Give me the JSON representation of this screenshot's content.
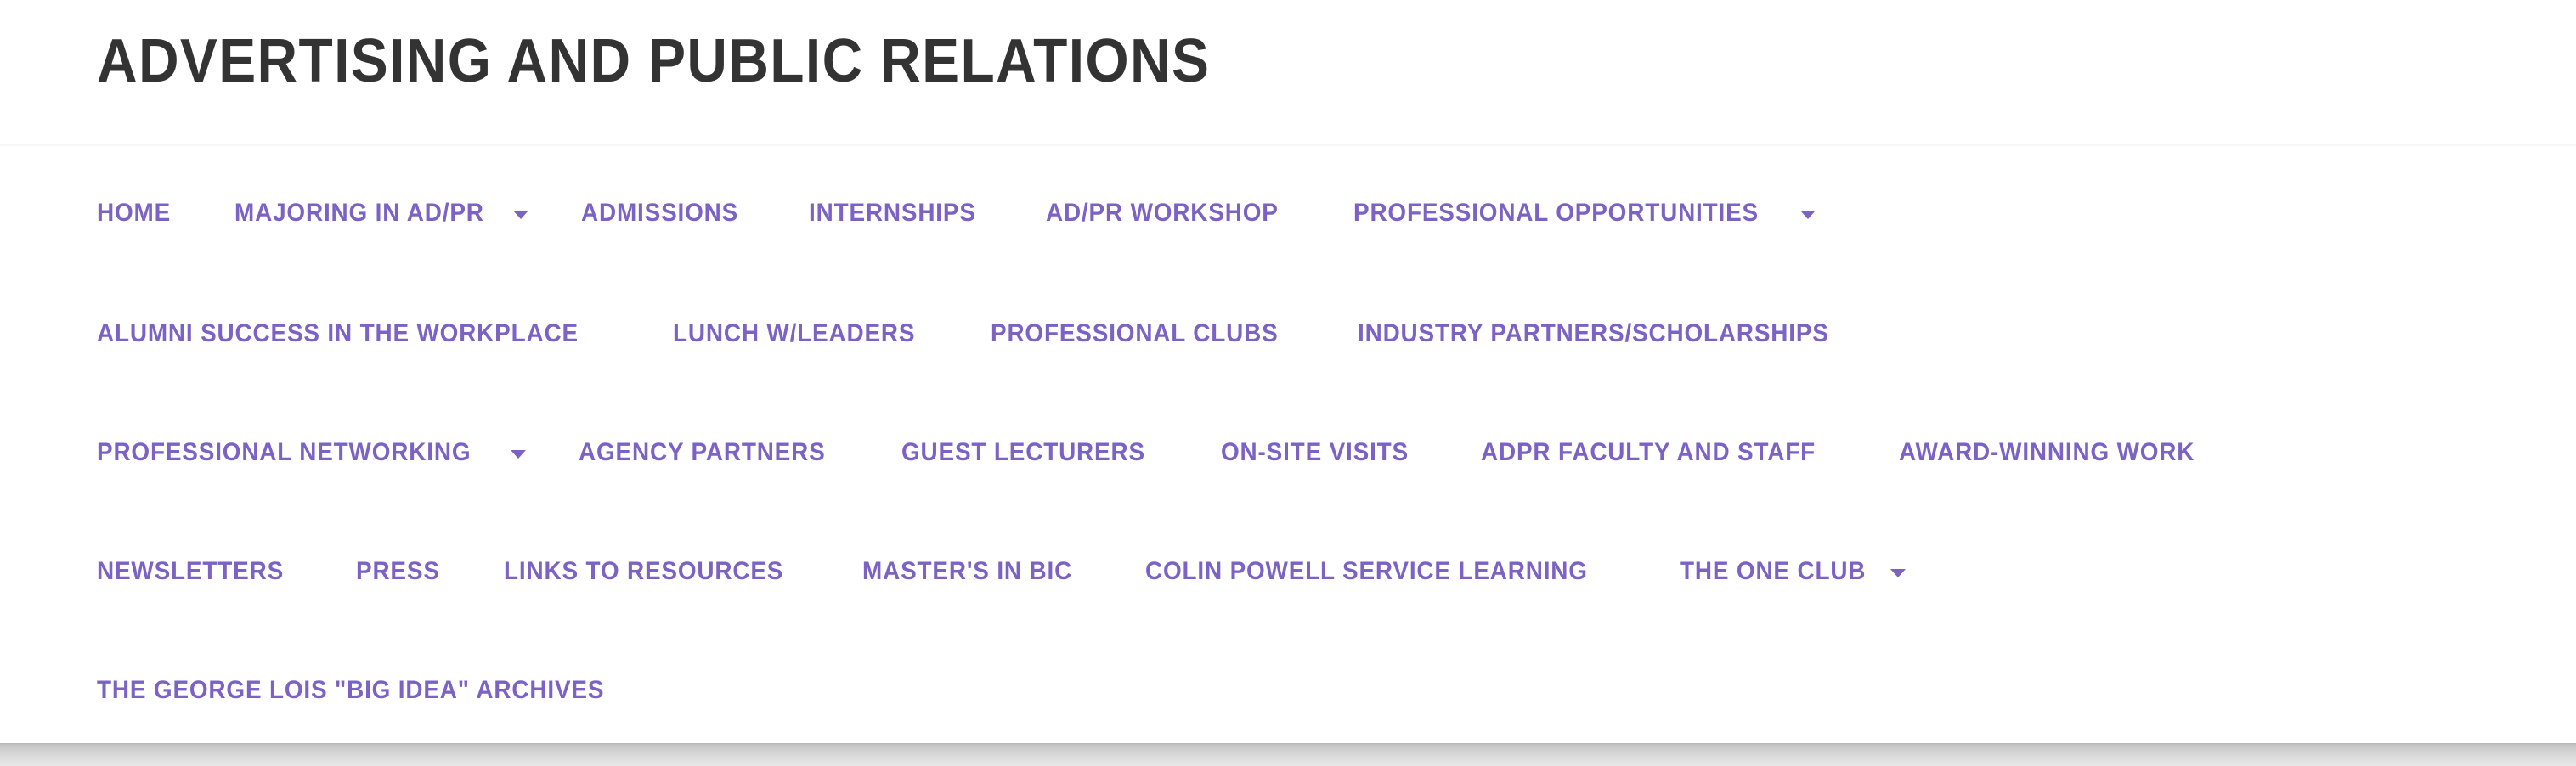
{
  "header": {
    "title": "ADVERTISING AND PUBLIC RELATIONS",
    "title_color": "#333333",
    "background_color": "#ffffff"
  },
  "theme": {
    "link_color": "#7b62c4",
    "link_hover_color": "#5f48a8",
    "page_background": "#ffffff",
    "divider_color": "#f7f7f8",
    "scrollbar_color": "#cccccc"
  },
  "nav": {
    "rows": [
      {
        "items": [
          {
            "label": "HOME",
            "has_dropdown": false,
            "caret_icon": ""
          },
          {
            "label": "MAJORING IN AD/PR",
            "has_dropdown": true,
            "caret_icon": "chevron-down-icon"
          },
          {
            "label": "ADMISSIONS",
            "has_dropdown": false,
            "caret_icon": ""
          },
          {
            "label": "INTERNSHIPS",
            "has_dropdown": false,
            "caret_icon": ""
          },
          {
            "label": "AD/PR WORKSHOP",
            "has_dropdown": false,
            "caret_icon": ""
          },
          {
            "label": "PROFESSIONAL OPPORTUNITIES",
            "has_dropdown": true,
            "caret_icon": "chevron-down-icon"
          }
        ]
      },
      {
        "items": [
          {
            "label": "ALUMNI SUCCESS IN THE WORKPLACE",
            "has_dropdown": false,
            "caret_icon": ""
          },
          {
            "label": "LUNCH W/LEADERS",
            "has_dropdown": false,
            "caret_icon": ""
          },
          {
            "label": "PROFESSIONAL CLUBS",
            "has_dropdown": false,
            "caret_icon": ""
          },
          {
            "label": "INDUSTRY PARTNERS/SCHOLARSHIPS",
            "has_dropdown": false,
            "caret_icon": ""
          }
        ]
      },
      {
        "items": [
          {
            "label": "PROFESSIONAL NETWORKING",
            "has_dropdown": true,
            "caret_icon": "chevron-down-icon"
          },
          {
            "label": "AGENCY PARTNERS",
            "has_dropdown": false,
            "caret_icon": ""
          },
          {
            "label": "GUEST LECTURERS",
            "has_dropdown": false,
            "caret_icon": ""
          },
          {
            "label": "ON-SITE VISITS",
            "has_dropdown": false,
            "caret_icon": ""
          },
          {
            "label": "ADPR FACULTY AND STAFF",
            "has_dropdown": false,
            "caret_icon": ""
          },
          {
            "label": "AWARD-WINNING WORK",
            "has_dropdown": false,
            "caret_icon": ""
          }
        ]
      },
      {
        "items": [
          {
            "label": "NEWSLETTERS",
            "has_dropdown": false,
            "caret_icon": ""
          },
          {
            "label": "PRESS",
            "has_dropdown": false,
            "caret_icon": ""
          },
          {
            "label": "LINKS TO RESOURCES",
            "has_dropdown": false,
            "caret_icon": ""
          },
          {
            "label": "MASTER'S IN BIC",
            "has_dropdown": false,
            "caret_icon": ""
          },
          {
            "label": "COLIN POWELL SERVICE LEARNING",
            "has_dropdown": false,
            "caret_icon": ""
          },
          {
            "label": "THE ONE CLUB",
            "has_dropdown": true,
            "caret_icon": "chevron-down-icon"
          }
        ]
      },
      {
        "items": [
          {
            "label": "THE GEORGE LOIS \"BIG IDEA\" ARCHIVES",
            "has_dropdown": false,
            "caret_icon": ""
          }
        ]
      }
    ]
  },
  "scrollbar": {
    "orientation": "horizontal",
    "name": "horizontal-scrollbar"
  }
}
